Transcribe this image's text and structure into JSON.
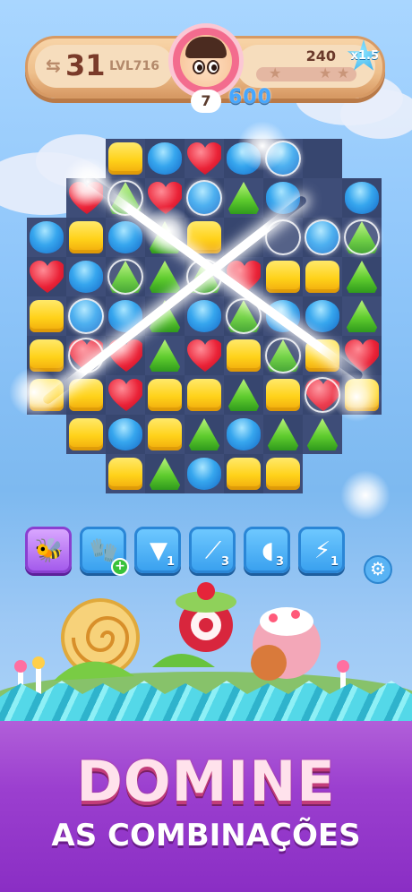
{
  "hud": {
    "moves": "31",
    "level": "LVL716",
    "score": "240",
    "multiplier": "x1.5",
    "avatar_badge": "7",
    "progress": 0.0
  },
  "board": {
    "score_popup": "600"
  },
  "boosters": [
    {
      "name": "booster-bees",
      "count": "",
      "active": true
    },
    {
      "name": "booster-oven-mitt",
      "count": "",
      "add": true
    },
    {
      "name": "booster-piping-bag",
      "count": "1"
    },
    {
      "name": "booster-candy-cane",
      "count": "3"
    },
    {
      "name": "booster-spoon",
      "count": "3"
    },
    {
      "name": "booster-lightning-bulb",
      "count": "1"
    }
  ],
  "headline": {
    "title": "DOMINE",
    "subtitle": "AS COMBINAÇÕES"
  },
  "colors": {
    "hud": "#eebf8b",
    "board": "#3e4d78",
    "booster": "#3aa1ef",
    "title": "#ffe2ec",
    "background_bottom": "#9b3fcf"
  }
}
